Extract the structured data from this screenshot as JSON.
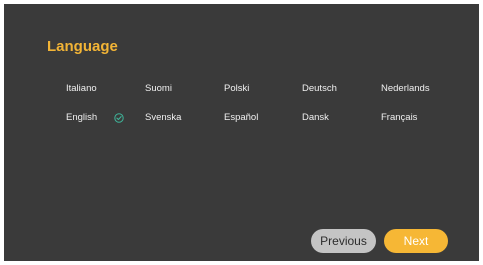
{
  "header": {
    "title": "Language"
  },
  "languages": [
    {
      "label": "Italiano"
    },
    {
      "label": "Suomi"
    },
    {
      "label": "Polski"
    },
    {
      "label": "Deutsch"
    },
    {
      "label": "Nederlands"
    },
    {
      "label": "English",
      "selected": true
    },
    {
      "label": "Svenska"
    },
    {
      "label": "Español"
    },
    {
      "label": "Dansk"
    },
    {
      "label": "Français"
    }
  ],
  "selected_icon": "check-circle-icon",
  "footer": {
    "previous_label": "Previous",
    "next_label": "Next"
  },
  "colors": {
    "background": "#3a3a3a",
    "accent": "#f2b436",
    "check": "#3fb59a",
    "previous_button": "#c4c4c4",
    "next_button": "#f6b735"
  }
}
